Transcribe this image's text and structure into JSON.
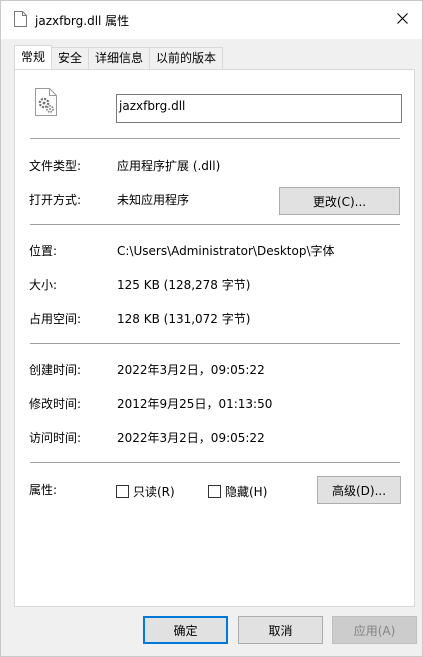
{
  "window": {
    "title": "jazxfbrg.dll 属性"
  },
  "tabs": [
    {
      "label": "常规",
      "active": true
    },
    {
      "label": "安全",
      "active": false
    },
    {
      "label": "详细信息",
      "active": false
    },
    {
      "label": "以前的版本",
      "active": false
    }
  ],
  "general": {
    "file_name": "jazxfbrg.dll",
    "file_type_label": "文件类型:",
    "file_type_value": "应用程序扩展 (.dll)",
    "opens_with_label": "打开方式:",
    "opens_with_value": "未知应用程序",
    "change_button": "更改(C)...",
    "location_label": "位置:",
    "location_value": "C:\\Users\\Administrator\\Desktop\\字体",
    "size_label": "大小:",
    "size_value": "125 KB (128,278 字节)",
    "size_on_disk_label": "占用空间:",
    "size_on_disk_value": "128 KB (131,072 字节)",
    "created_label": "创建时间:",
    "created_value": "2022年3月2日，09:05:22",
    "modified_label": "修改时间:",
    "modified_value": "2012年9月25日，01:13:50",
    "accessed_label": "访问时间:",
    "accessed_value": "2022年3月2日，09:05:22",
    "attributes_label": "属性:",
    "readonly_label": "只读(R)",
    "readonly_checked": false,
    "hidden_label": "隐藏(H)",
    "hidden_checked": false,
    "advanced_button": "高级(D)..."
  },
  "footer": {
    "ok": "确定",
    "cancel": "取消",
    "apply": "应用(A)"
  },
  "colors": {
    "accent": "#0078d7",
    "panel_bg": "#ffffff",
    "window_bg": "#f0f0f0"
  },
  "icons": {
    "title": "file-page-icon",
    "close": "close-icon",
    "file": "dll-gear-file-icon"
  }
}
